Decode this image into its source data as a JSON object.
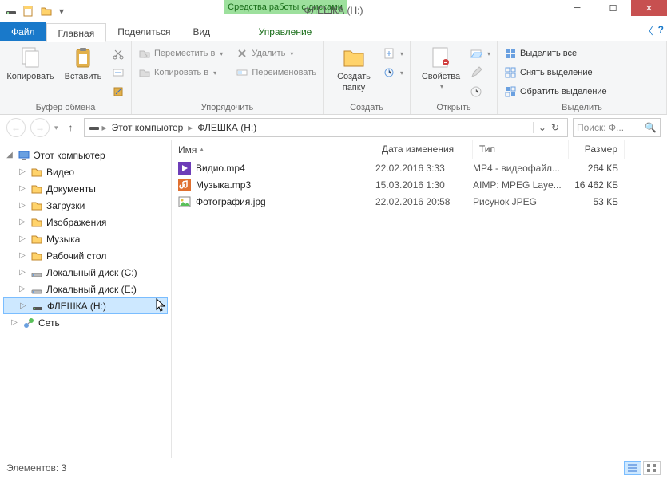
{
  "title": "ФЛЕШКА (H:)",
  "contextual_tab_label": "Средства работы с дисками",
  "tabs": {
    "file": "Файл",
    "home": "Главная",
    "share": "Поделиться",
    "view": "Вид",
    "manage": "Управление"
  },
  "ribbon": {
    "clipboard": {
      "copy": "Копировать",
      "paste": "Вставить",
      "label": "Буфер обмена"
    },
    "organize": {
      "move_to": "Переместить в",
      "copy_to": "Копировать в",
      "delete": "Удалить",
      "rename": "Переименовать",
      "label": "Упорядочить"
    },
    "new": {
      "new_folder_line1": "Создать",
      "new_folder_line2": "папку",
      "label": "Создать"
    },
    "open": {
      "properties": "Свойства",
      "label": "Открыть"
    },
    "select": {
      "select_all": "Выделить все",
      "select_none": "Снять выделение",
      "invert": "Обратить выделение",
      "label": "Выделить"
    }
  },
  "breadcrumbs": {
    "root": "Этот компьютер",
    "current": "ФЛЕШКА (H:)"
  },
  "search_placeholder": "Поиск: Ф...",
  "tree": {
    "root": "Этот компьютер",
    "items": [
      "Видео",
      "Документы",
      "Загрузки",
      "Изображения",
      "Музыка",
      "Рабочий стол",
      "Локальный диск (C:)",
      "Локальный диск (E:)",
      "ФЛЕШКА (H:)"
    ],
    "network": "Сеть"
  },
  "columns": {
    "name": "Имя",
    "date": "Дата изменения",
    "type": "Тип",
    "size": "Размер"
  },
  "files": [
    {
      "name": "Видио.mp4",
      "date": "22.02.2016 3:33",
      "type": "MP4 - видеофайл...",
      "size": "264 КБ",
      "icon": "video"
    },
    {
      "name": "Музыка.mp3",
      "date": "15.03.2016 1:30",
      "type": "AIMP: MPEG Laye...",
      "size": "16 462 КБ",
      "icon": "audio"
    },
    {
      "name": "Фотография.jpg",
      "date": "22.02.2016 20:58",
      "type": "Рисунок JPEG",
      "size": "53 КБ",
      "icon": "image"
    }
  ],
  "status": {
    "items_label": "Элементов:",
    "items_count": "3"
  },
  "colors": {
    "accent": "#1979ca",
    "contextual": "#9de09d",
    "selection": "#cde8ff"
  }
}
